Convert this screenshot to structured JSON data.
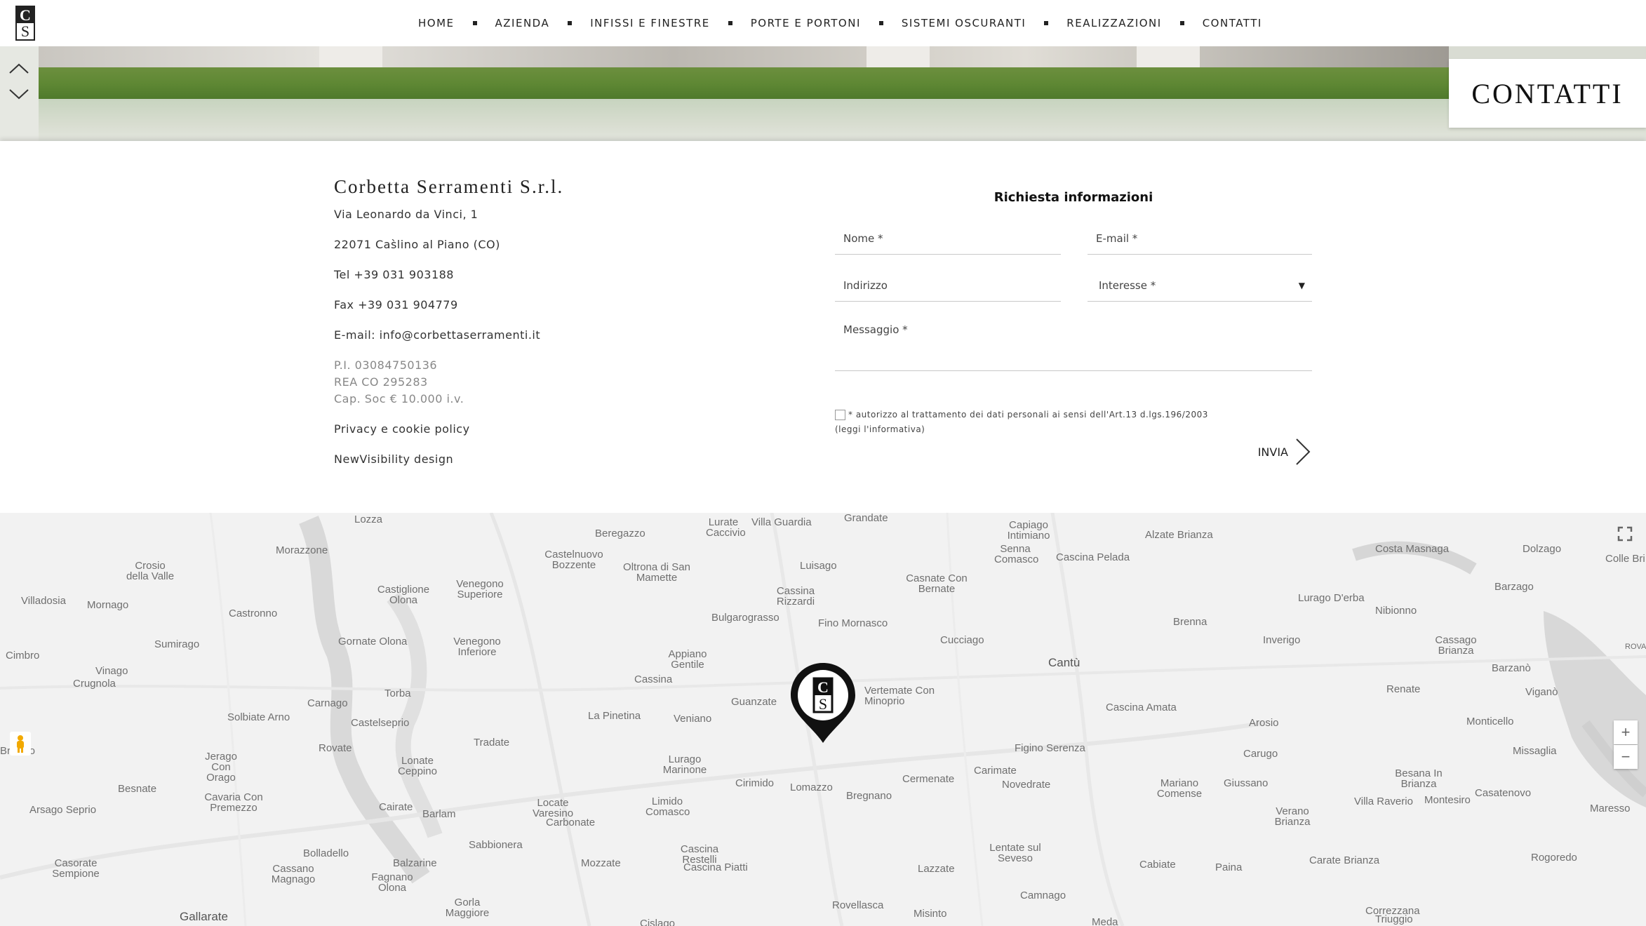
{
  "header": {
    "logo_letters": [
      "C",
      "S"
    ],
    "nav": [
      "HOME",
      "AZIENDA",
      "INFISSI E FINESTRE",
      "PORTE E PORTONI",
      "SISTEMI OSCURANTI",
      "REALIZZAZIONI",
      "CONTATTI"
    ]
  },
  "hero": {
    "title": "CONTATTI"
  },
  "company": {
    "name": "Corbetta Serramenti S.r.l.",
    "address": "Via Leonardo da Vinci, 1",
    "city": "22071 Cas̀lino al Piano (CO)",
    "tel": "Tel +39 031 903188",
    "fax": "Fax +39 031 904779",
    "email_prefix": "E-mail: ",
    "email": "info@corbettaserramenti.it",
    "piva": "P.I. 03084750136",
    "rea": "REA CO 295283",
    "capital": "Cap. Soc € 10.000 i.v.",
    "privacy": "Privacy e cookie policy",
    "credit": "NewVisibility design"
  },
  "form": {
    "title": "Richiesta informazioni",
    "name_ph": "Nome *",
    "email_ph": "E-mail *",
    "address_ph": "Indirizzo",
    "interest_ph": "Interesse *",
    "message_ph": "Messaggio *",
    "consent": "* autorizzo al trattamento dei dati personali ai sensi dell'Art.13 d.lgs.196/2003",
    "informativa": "(leggi l'informativa)",
    "submit": "INVIA"
  },
  "map": {
    "labels": [
      "Lozza",
      "Beregazzo",
      "Lurate Caccivio",
      "Villa Guardia",
      "Grandate",
      "Capiago Intimiano",
      "Senna Comasco",
      "Alzate Brianza",
      "Cascina Pelada",
      "Costa Masnaga",
      "Dolzago",
      "Colle Bri",
      "Morazzone",
      "Crosio della Valle",
      "Castelnuovo Bozzente",
      "Oltrona di San Mamette",
      "Luisago",
      "Casnate Con Bernate",
      "Villadosia",
      "Mornago",
      "Castiglione Olona",
      "Venegono Superiore",
      "Cassina Rizzardi",
      "Lurago D'erba",
      "Barzago",
      "Castronno",
      "Bulgarograsso",
      "Fino Mornasco",
      "Brenna",
      "Nibionno",
      "Cimbro",
      "Sumirago",
      "Gornate Olona",
      "Venegono Inferiore",
      "Cucciago",
      "Inverigo",
      "Cassago Brianza",
      "Vinago",
      "Crugnola",
      "Appiano Gentile",
      "Cantù",
      "Barzanò",
      "Cassina",
      "Cascina Amata",
      "Renate",
      "Viganò",
      "Carnago",
      "Torba",
      "Guanzate",
      "Vertemate Con Minoprio",
      "Arosio",
      "Monticello",
      "Solbiate Arno",
      "Castelseprio",
      "La Pinetina",
      "Veniano",
      "Rovate",
      "Tradate",
      "Figino Serenza",
      "Carugo",
      "Briosco",
      "Missaglia",
      "Jerago Con Orago",
      "Lonate Ceppino",
      "Lurago Marinone",
      "Cirimido",
      "Lomazzo",
      "Cermenate",
      "Carimate",
      "Novedrate",
      "Mariano Comense",
      "Giussano",
      "Besana In Brianza",
      "Besnate",
      "Cavaria Con Premezzo",
      "Bregnano",
      "Casatenovo",
      "Villa Raverio",
      "Montesiro",
      "Arsago Seprio",
      "Cairate",
      "Barlam",
      "Locate Varesino",
      "Limido Comasco",
      "Carbonate",
      "Verano Brianza",
      "Maresso",
      "Sabbionera",
      "Cascina Restelli",
      "Lentate sul Seveso",
      "Bolladello",
      "Rogoredo",
      "Carate Brianza",
      "Casorate Sempione",
      "Balzarine",
      "Mozzate",
      "Cascina Piatti",
      "Lazzate",
      "Cabiate",
      "Paina",
      "Cassano Magnago",
      "Fagnano Olona",
      "Camnago",
      "Gorla Maggiore",
      "Rovellasca",
      "Misinto",
      "Correzzana",
      "Gallarate",
      "Cislago",
      "Meda",
      "Triuggio",
      "ROVA"
    ],
    "zoom_in": "+",
    "zoom_out": "−"
  }
}
